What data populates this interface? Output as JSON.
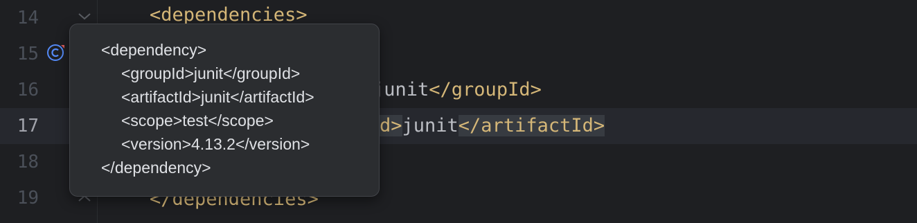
{
  "editor": {
    "lines": [
      {
        "number": "14",
        "code_visible": "<dependencies>"
      },
      {
        "number": "15",
        "code_visible": ""
      },
      {
        "number": "16",
        "tail_text": "junit",
        "tail_close": "</groupId>"
      },
      {
        "number": "17",
        "tail_close_open_fragment": "d>",
        "tail_text": "junit",
        "tail_close": "</artifactId>"
      },
      {
        "number": "18",
        "code_visible": ""
      },
      {
        "number": "19",
        "code_visible": "</dependencies>"
      }
    ],
    "current_line": "17"
  },
  "popup": {
    "lines": [
      "<dependency>",
      "<groupId>junit</groupId>",
      "<artifactId>junit</artifactId>",
      "<scope>test</scope>",
      "<version>4.13.2</version>",
      "</dependency>"
    ]
  },
  "colors": {
    "background": "#1e1f22",
    "current_line": "#26282e",
    "tag": "#d5b778",
    "text": "#bcbec4",
    "popup_background": "#2b2d30",
    "badge_accent": "#548af7"
  },
  "icons": {
    "gutter_badge": "maven-dependency-icon",
    "fold_open": "fold-chevron-down-icon",
    "fold_close": "fold-chevron-up-icon"
  }
}
